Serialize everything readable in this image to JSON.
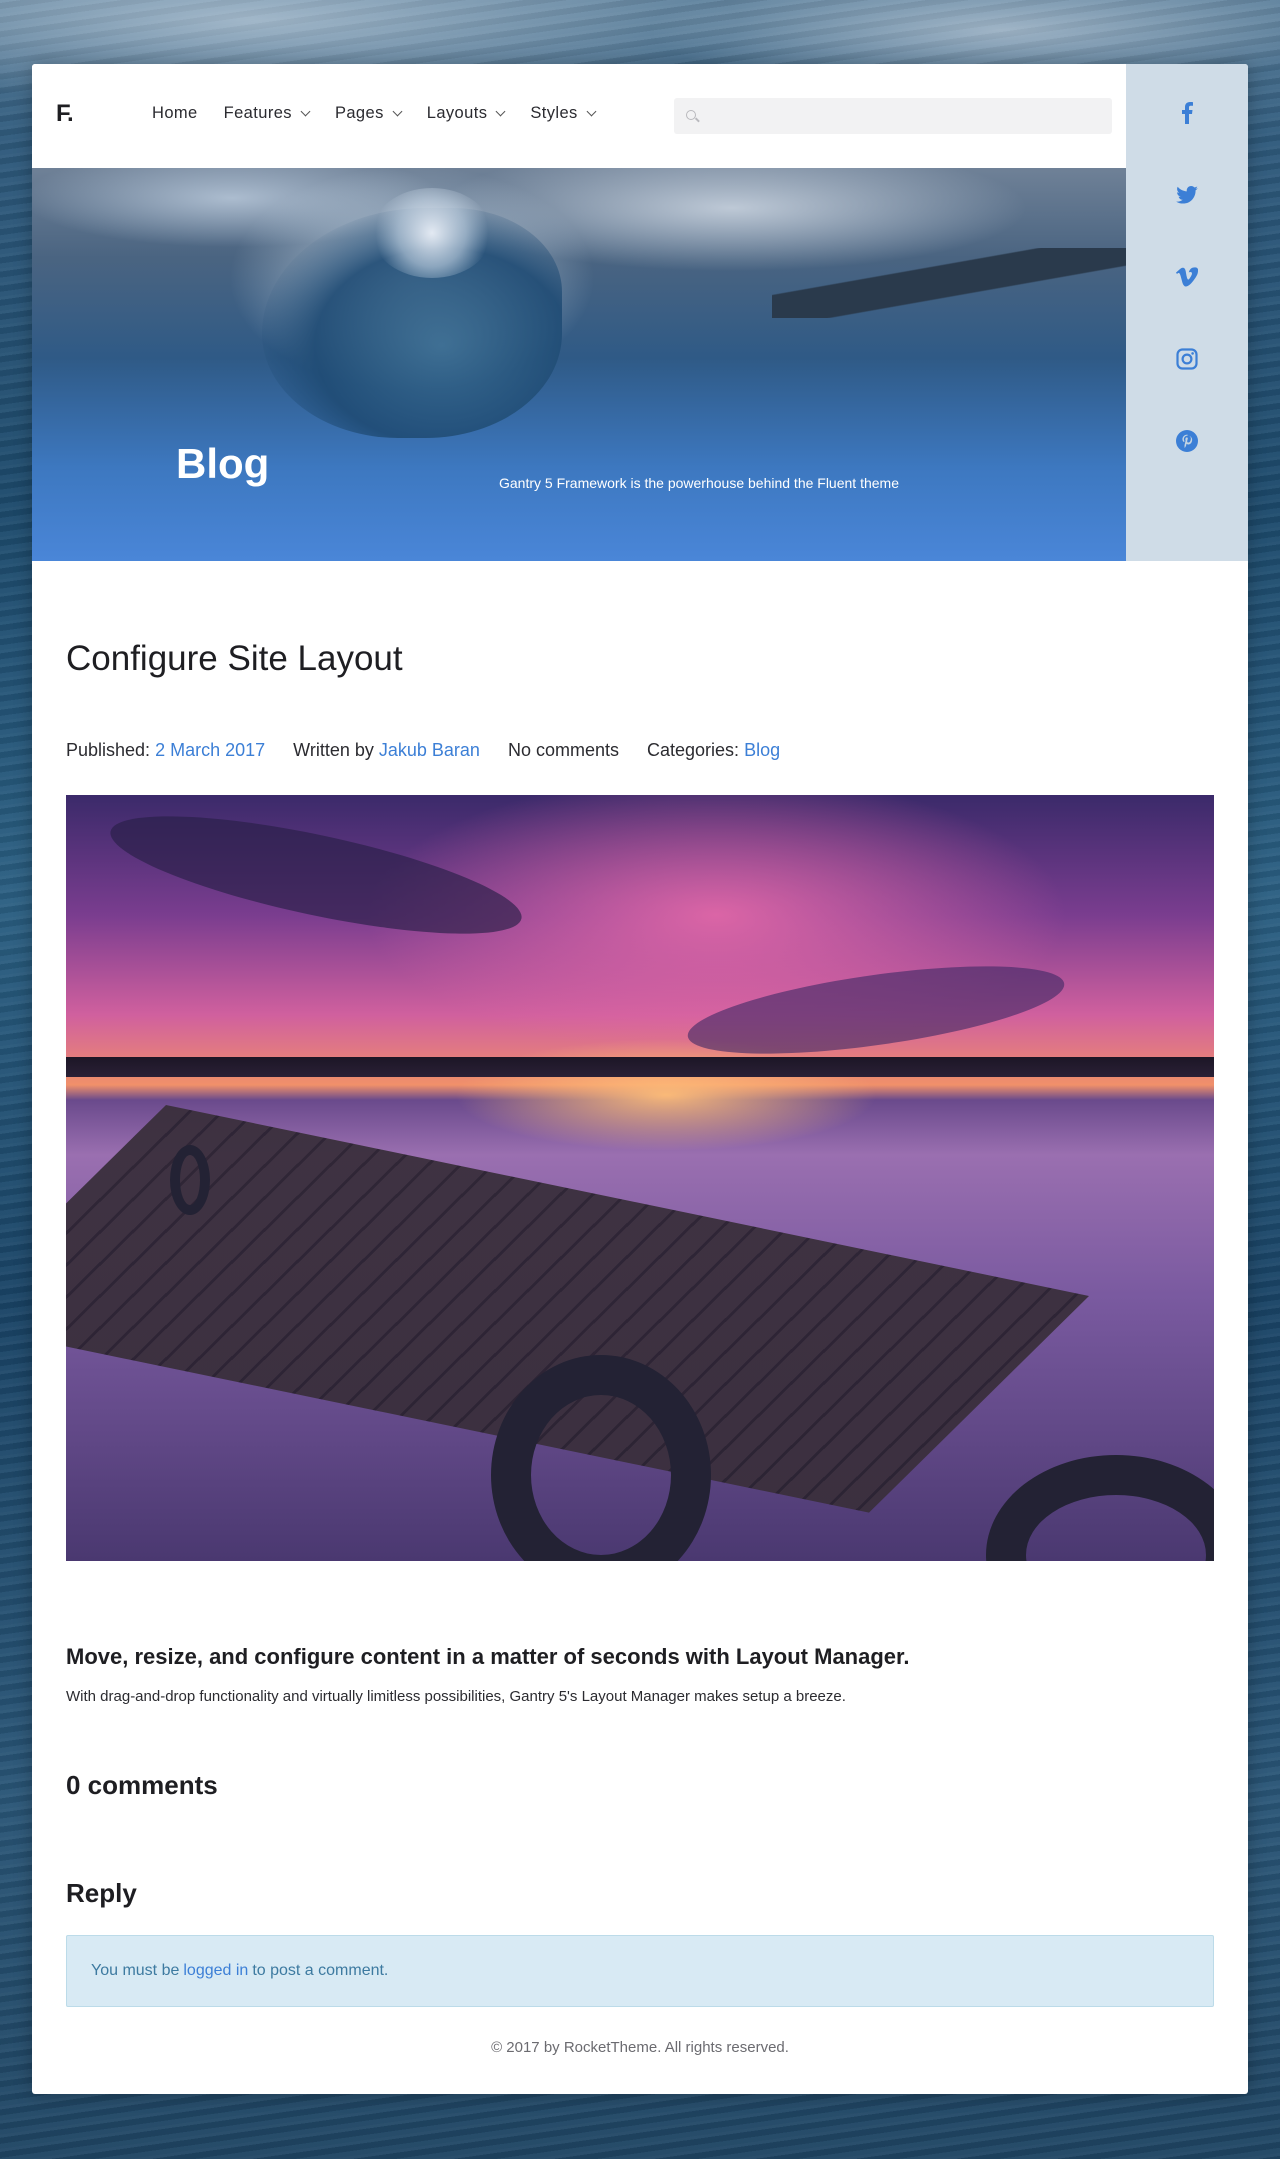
{
  "header": {
    "logo": "F.",
    "nav": [
      {
        "label": "Home",
        "dropdown": false
      },
      {
        "label": "Features",
        "dropdown": true
      },
      {
        "label": "Pages",
        "dropdown": true
      },
      {
        "label": "Layouts",
        "dropdown": true
      },
      {
        "label": "Styles",
        "dropdown": true
      }
    ],
    "search": {
      "placeholder": "",
      "value": ""
    }
  },
  "social": {
    "color": "#3c7fd6",
    "icons": [
      "facebook-icon",
      "twitter-icon",
      "vimeo-icon",
      "instagram-icon",
      "pinterest-icon"
    ]
  },
  "hero": {
    "title": "Blog",
    "tagline": "Gantry 5 Framework is the powerhouse behind the Fluent theme"
  },
  "article": {
    "title": "Configure Site Layout",
    "meta": {
      "published_label": "Published:",
      "published_date": "2 March 2017",
      "written_label": "Written by",
      "author": "Jakub Baran",
      "comments": "No comments",
      "categories_label": "Categories:",
      "category": "Blog"
    },
    "lead": "Move, resize, and configure content in a matter of seconds with Layout Manager.",
    "intro": "With drag-and-drop functionality and virtually limitless possibilities, Gantry 5's Layout Manager makes setup a breeze."
  },
  "comments": {
    "heading": "0 comments",
    "reply_heading": "Reply",
    "notice_before": "You must be",
    "notice_link": "logged in",
    "notice_after": "to post a comment."
  },
  "footer": {
    "text": "© 2017 by RocketTheme. All rights reserved."
  },
  "colors": {
    "accent": "#3c7fd6",
    "notice_bg": "#d8eaf4"
  }
}
